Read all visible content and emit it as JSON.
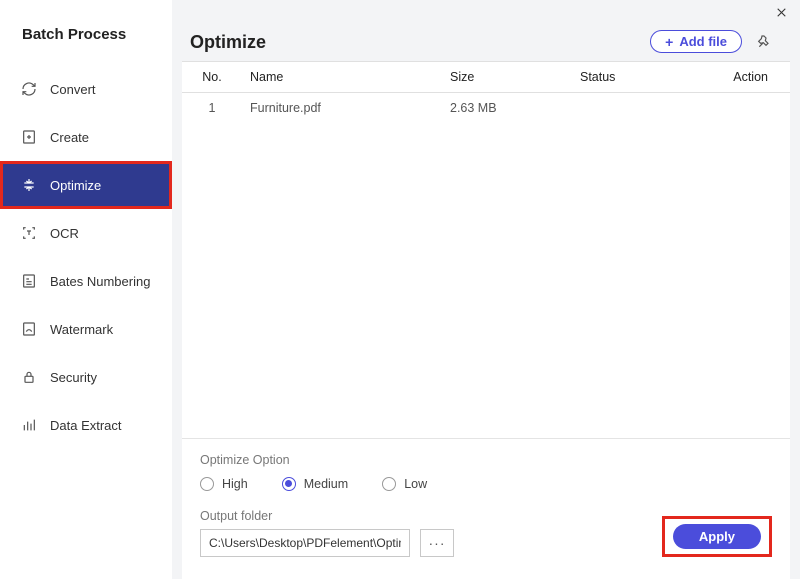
{
  "sidebar": {
    "title": "Batch Process",
    "items": [
      {
        "label": "Convert",
        "icon": "convert-icon",
        "active": false
      },
      {
        "label": "Create",
        "icon": "create-icon",
        "active": false
      },
      {
        "label": "Optimize",
        "icon": "optimize-icon",
        "active": true
      },
      {
        "label": "OCR",
        "icon": "ocr-icon",
        "active": false
      },
      {
        "label": "Bates Numbering",
        "icon": "bates-icon",
        "active": false
      },
      {
        "label": "Watermark",
        "icon": "watermark-icon",
        "active": false
      },
      {
        "label": "Security",
        "icon": "security-icon",
        "active": false
      },
      {
        "label": "Data Extract",
        "icon": "data-icon",
        "active": false
      }
    ]
  },
  "header": {
    "title": "Optimize",
    "add_file_label": "Add file"
  },
  "table": {
    "columns": {
      "no": "No.",
      "name": "Name",
      "size": "Size",
      "status": "Status",
      "action": "Action"
    },
    "rows": [
      {
        "no": "1",
        "name": "Furniture.pdf",
        "size": "2.63 MB",
        "status": "",
        "action": ""
      }
    ]
  },
  "options": {
    "label": "Optimize Option",
    "choices": {
      "high": "High",
      "medium": "Medium",
      "low": "Low"
    },
    "selected": "medium"
  },
  "output": {
    "label": "Output folder",
    "path": "C:\\Users\\Desktop\\PDFelement\\Optimize"
  },
  "actions": {
    "apply": "Apply",
    "more": "···"
  }
}
